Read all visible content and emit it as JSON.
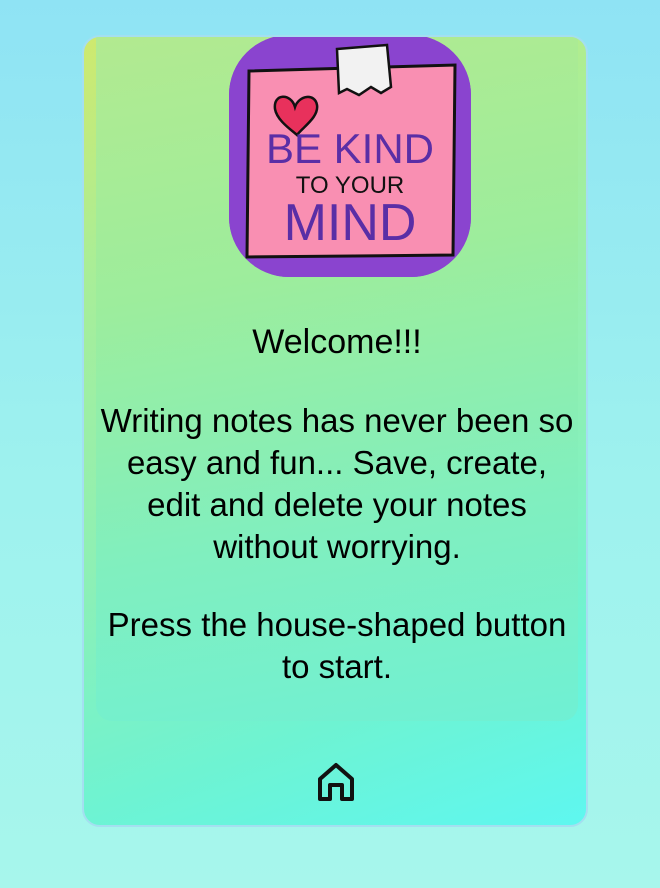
{
  "logo": {
    "line1": "BE KIND",
    "line2": "TO YOUR",
    "line3": "MIND",
    "bg_color": "#8a44cf",
    "note_color": "#f98fb2",
    "heart_color": "#e8315c"
  },
  "content": {
    "welcome": "Welcome!!!",
    "description": "Writing notes has never been so easy and fun... Save, create, edit and delete your notes without worrying.",
    "instruction": "Press the house-shaped button to start."
  },
  "footer": {
    "home_icon": "home-icon"
  }
}
